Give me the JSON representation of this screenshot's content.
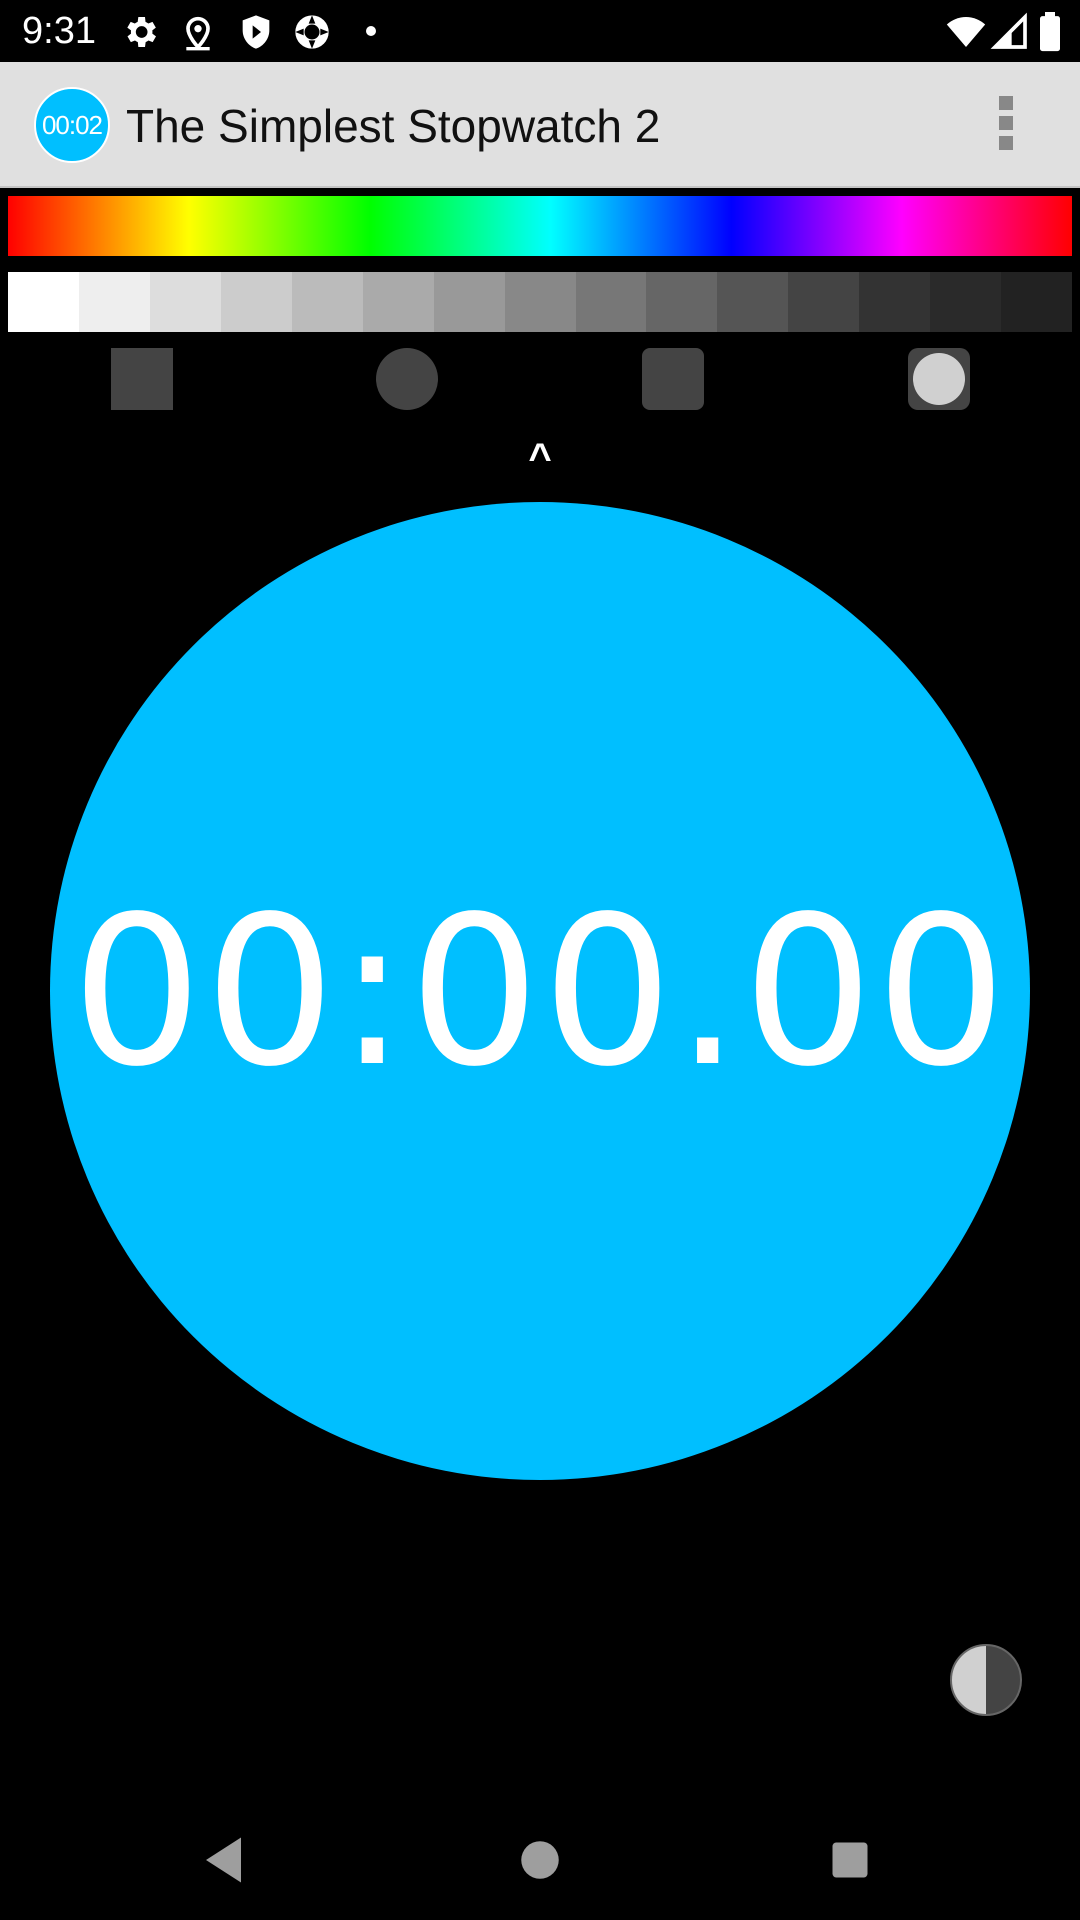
{
  "status_bar": {
    "time": "9:31",
    "left_icons": [
      "gear-icon",
      "location-pin-icon",
      "shield-play-icon",
      "camera-aperture-icon",
      "notification-dot-icon"
    ],
    "right_icons": [
      "wifi-icon",
      "cell-signal-icon",
      "battery-icon"
    ]
  },
  "app_bar": {
    "logo_text": "00:02",
    "title": "The Simplest Stopwatch 2",
    "menu_icon": "overflow-menu-icon"
  },
  "palette": {
    "hue_colors": [
      "#ff0000",
      "#ffff00",
      "#00ff00",
      "#00ffff",
      "#0000ff",
      "#ff00ff",
      "#ff0000"
    ],
    "gray_swatches": [
      "#ffffff",
      "#eeeeee",
      "#dddddd",
      "#cccccc",
      "#bbbbbb",
      "#aaaaaa",
      "#999999",
      "#888888",
      "#777777",
      "#666666",
      "#555555",
      "#444444",
      "#333333",
      "#2a2a2a",
      "#222222"
    ]
  },
  "shape_options": [
    "square",
    "circle",
    "rounded-square",
    "circle-in-rounded-square"
  ],
  "shape_selected": "circle-in-rounded-square",
  "caret": "^",
  "stopwatch": {
    "time": "00:00.00",
    "face_color": "#00bfff",
    "text_color": "#ffffff"
  },
  "contrast_toggle_icon": "contrast-icon",
  "nav_bar": {
    "icons": [
      "back-icon",
      "home-icon",
      "recents-icon"
    ]
  }
}
